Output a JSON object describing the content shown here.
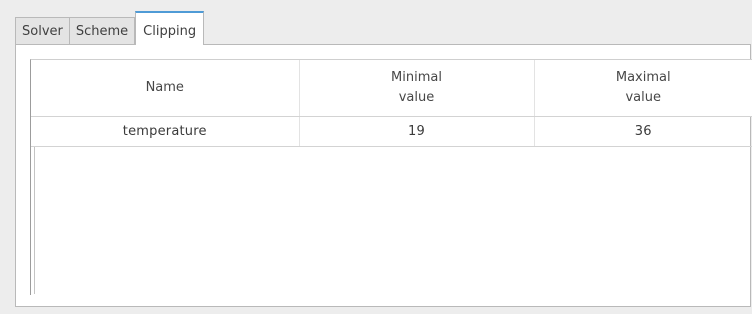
{
  "tabs": [
    {
      "label": "Solver",
      "active": false
    },
    {
      "label": "Scheme",
      "active": false
    },
    {
      "label": "Clipping",
      "active": true
    }
  ],
  "table": {
    "columns": [
      {
        "line1": "Name",
        "line2": ""
      },
      {
        "line1": "Minimal",
        "line2": "value"
      },
      {
        "line1": "Maximal",
        "line2": "value"
      }
    ],
    "rows": [
      {
        "name": "temperature",
        "min": "19",
        "max": "36"
      }
    ]
  },
  "colors": {
    "active_tab_accent": "#4f9bd6",
    "window_background": "#ededed",
    "panel_background": "#ffffff"
  }
}
